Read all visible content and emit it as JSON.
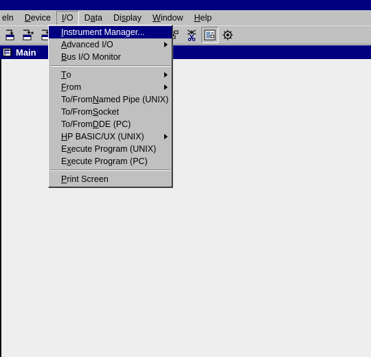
{
  "window": {
    "titlebar_color": "#000080",
    "face_color": "#c0c0c0",
    "client_color": "#eeeeee"
  },
  "menubar": {
    "items": [
      {
        "label": "eln",
        "mnemonic": "",
        "state": "normal"
      },
      {
        "label": "Device",
        "mnemonic": "D",
        "state": "normal"
      },
      {
        "label": "I/O",
        "mnemonic": "I",
        "state": "open"
      },
      {
        "label": "Data",
        "mnemonic": "a",
        "state": "normal"
      },
      {
        "label": "Display",
        "mnemonic": "s",
        "state": "normal"
      },
      {
        "label": "Window",
        "mnemonic": "W",
        "state": "normal"
      },
      {
        "label": "Help",
        "mnemonic": "H",
        "state": "normal"
      }
    ]
  },
  "toolbar": {
    "buttons": [
      {
        "name": "add-instrument-icon",
        "title": "Add Instrument"
      },
      {
        "name": "add-device-icon",
        "title": "Add Device"
      },
      {
        "name": "add-locked-device-icon",
        "title": "Add Locked Device"
      },
      {
        "name": "properties-icon",
        "title": "Properties"
      },
      {
        "name": "function-icon",
        "title": "Function"
      },
      {
        "name": "cut-icon",
        "title": "Cut"
      },
      {
        "name": "copy-icon",
        "title": "Copy"
      },
      {
        "name": "paste-icon",
        "title": "Paste"
      },
      {
        "name": "arrange-icon",
        "title": "Arrange"
      },
      {
        "name": "cut-line-icon",
        "title": "Cut Line"
      },
      {
        "name": "panel-view-icon",
        "title": "Panel View"
      },
      {
        "name": "run-icon",
        "title": "Run"
      }
    ]
  },
  "mdi": {
    "title": "Main",
    "sysicon": "document-icon"
  },
  "dropdown": {
    "owner": "I/O",
    "items": [
      {
        "type": "item",
        "label": "Instrument Manager...",
        "mnemonic": "I",
        "selected": true,
        "submenu": false
      },
      {
        "type": "item",
        "label": "Advanced I/O",
        "mnemonic": "A",
        "selected": false,
        "submenu": true
      },
      {
        "type": "item",
        "label": "Bus I/O Monitor",
        "mnemonic": "B",
        "selected": false,
        "submenu": false
      },
      {
        "type": "separator"
      },
      {
        "type": "item",
        "label": "To",
        "mnemonic": "T",
        "selected": false,
        "submenu": true
      },
      {
        "type": "item",
        "label": "From",
        "mnemonic": "F",
        "selected": false,
        "submenu": true
      },
      {
        "type": "item",
        "label": "To/From Named Pipe (UNIX)",
        "mnemonic": "N",
        "selected": false,
        "submenu": false
      },
      {
        "type": "item",
        "label": "To/From Socket",
        "mnemonic": "S",
        "selected": false,
        "submenu": false
      },
      {
        "type": "item",
        "label": "To/From DDE (PC)",
        "mnemonic": "D",
        "selected": false,
        "submenu": false
      },
      {
        "type": "item",
        "label": "HP BASIC/UX (UNIX)",
        "mnemonic": "H",
        "selected": false,
        "submenu": true
      },
      {
        "type": "item",
        "label": "Execute Program (UNIX)",
        "mnemonic": "x",
        "selected": false,
        "submenu": false
      },
      {
        "type": "item",
        "label": "Execute Program (PC)",
        "mnemonic": "x",
        "selected": false,
        "submenu": false
      },
      {
        "type": "separator"
      },
      {
        "type": "item",
        "label": "Print Screen",
        "mnemonic": "P",
        "selected": false,
        "submenu": false
      }
    ]
  }
}
